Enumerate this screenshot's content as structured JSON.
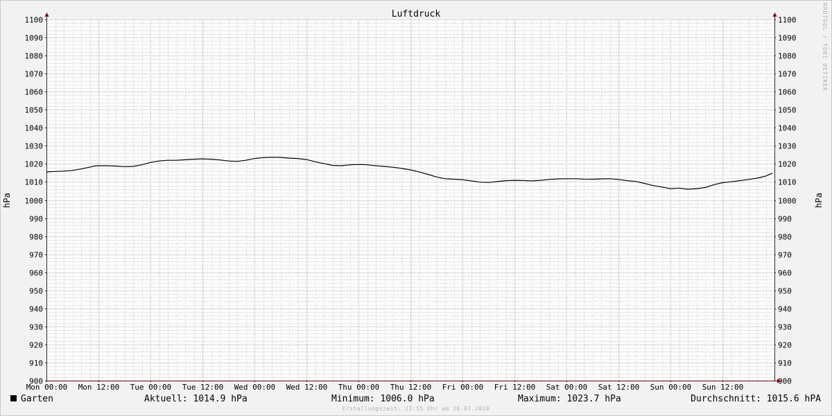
{
  "chart_data": {
    "type": "line",
    "title": "Luftdruck",
    "ylabel": "hPa",
    "ylim": [
      900,
      1100
    ],
    "yticks": [
      900,
      910,
      920,
      930,
      940,
      950,
      960,
      970,
      980,
      990,
      1000,
      1010,
      1020,
      1030,
      1040,
      1050,
      1060,
      1070,
      1080,
      1090,
      1100
    ],
    "xlim": [
      0,
      168
    ],
    "xticks": [
      {
        "label": "Mon 00:00",
        "hour": 0
      },
      {
        "label": "Mon 12:00",
        "hour": 12
      },
      {
        "label": "Tue 00:00",
        "hour": 24
      },
      {
        "label": "Tue 12:00",
        "hour": 36
      },
      {
        "label": "Wed 00:00",
        "hour": 48
      },
      {
        "label": "Wed 12:00",
        "hour": 60
      },
      {
        "label": "Thu 00:00",
        "hour": 72
      },
      {
        "label": "Thu 12:00",
        "hour": 84
      },
      {
        "label": "Fri 00:00",
        "hour": 96
      },
      {
        "label": "Fri 12:00",
        "hour": 108
      },
      {
        "label": "Sat 00:00",
        "hour": 120
      },
      {
        "label": "Sat 12:00",
        "hour": 132
      },
      {
        "label": "Sun 00:00",
        "hour": 144
      },
      {
        "label": "Sun 12:00",
        "hour": 156
      }
    ],
    "grid": true,
    "series": [
      {
        "name": "Garten",
        "color": "#000000",
        "x": [
          0,
          2,
          4,
          6,
          8,
          10,
          11,
          12,
          14,
          16,
          18,
          20,
          22,
          24,
          26,
          28,
          30,
          32,
          34,
          36,
          38,
          40,
          42,
          44,
          46,
          48,
          50,
          52,
          54,
          56,
          58,
          60,
          62,
          64,
          66,
          68,
          70,
          72,
          74,
          76,
          78,
          80,
          82,
          84,
          86,
          88,
          90,
          92,
          94,
          96,
          98,
          100,
          102,
          104,
          106,
          108,
          110,
          112,
          114,
          116,
          118,
          120,
          122,
          124,
          126,
          128,
          130,
          132,
          134,
          136,
          138,
          140,
          142,
          144,
          146,
          148,
          150,
          152,
          154,
          156,
          158,
          160,
          162,
          164,
          166,
          167.5
        ],
        "y": [
          1015.6,
          1015.8,
          1016.0,
          1016.4,
          1017.2,
          1018.2,
          1018.8,
          1019.0,
          1019.0,
          1018.8,
          1018.5,
          1018.6,
          1019.5,
          1020.8,
          1021.6,
          1022.0,
          1022.0,
          1022.3,
          1022.6,
          1022.8,
          1022.6,
          1022.2,
          1021.6,
          1021.4,
          1022.0,
          1023.0,
          1023.5,
          1023.7,
          1023.6,
          1023.2,
          1023.0,
          1022.4,
          1021.2,
          1020.2,
          1019.2,
          1019.0,
          1019.5,
          1019.7,
          1019.5,
          1019.0,
          1018.6,
          1018.1,
          1017.5,
          1016.7,
          1015.6,
          1014.2,
          1012.8,
          1011.8,
          1011.5,
          1011.3,
          1010.6,
          1009.9,
          1009.7,
          1010.2,
          1010.7,
          1010.9,
          1010.8,
          1010.6,
          1010.9,
          1011.4,
          1011.7,
          1011.8,
          1011.8,
          1011.6,
          1011.5,
          1011.7,
          1011.8,
          1011.4,
          1010.7,
          1010.3,
          1009.2,
          1008.0,
          1007.2,
          1006.3,
          1006.6,
          1006.0,
          1006.3,
          1006.9,
          1008.5,
          1009.6,
          1010.1,
          1010.7,
          1011.4,
          1012.1,
          1013.3,
          1014.9
        ]
      }
    ],
    "legend": "bottom-left"
  },
  "legend": {
    "series_name": "Garten",
    "aktuell": "Aktuell: 1014.9 hPa",
    "minimum": "Minimum: 1006.0 hPa",
    "maximum": "Maximum: 1023.7 hPa",
    "durchschnitt": "Durchschnitt: 1015.6 hPA"
  },
  "footer": "Erstellungszeit: 23:55 Uhr am 26.07.2020",
  "watermark": "RRDTOOL / TOBI OETIKER",
  "colors": {
    "background": "#f2f2f2",
    "canvas": "#ffffff",
    "grid_major": "#e6a5a5",
    "grid_minor": "#d4d4d4",
    "axis": "#8b0000",
    "line": "#000000"
  }
}
